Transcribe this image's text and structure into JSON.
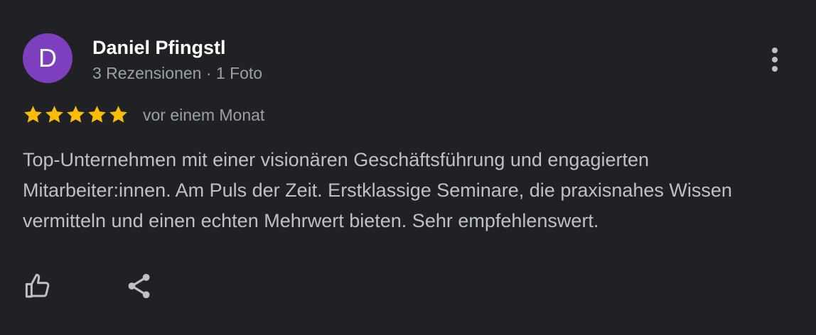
{
  "review": {
    "author": {
      "avatar_letter": "D",
      "avatar_color": "#7e3fbf",
      "name": "Daniel Pfingstl",
      "meta": "3 Rezensionen · 1 Foto"
    },
    "rating": {
      "value": 5,
      "max": 5,
      "star_color": "#fbbc04"
    },
    "date": "vor einem Monat",
    "text": "Top-Unternehmen mit einer visionären Geschäftsführung und engagierten Mitarbeiter:innen. Am Puls der Zeit. Erstklassige Seminare, die praxisnahes Wissen vermitteln und einen echten Mehrwert bieten. Sehr empfehlenswert.",
    "actions": {
      "like_icon": "thumbs-up-icon",
      "share_icon": "share-icon",
      "more_icon": "more-vertical-icon"
    }
  }
}
